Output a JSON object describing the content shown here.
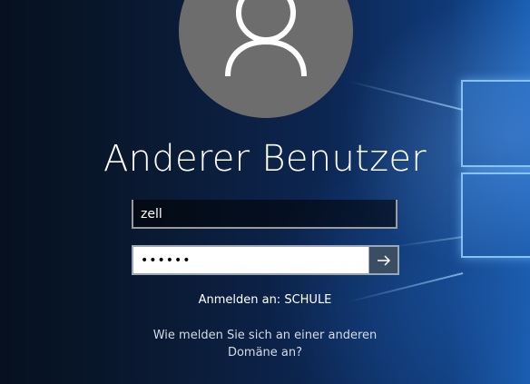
{
  "account": {
    "name": "Anderer Benutzer",
    "avatar_icon": "person-icon"
  },
  "login": {
    "username_value": "zell",
    "password_value": "••••••",
    "submit_icon": "arrow-right-icon"
  },
  "sign_in_to": "Anmelden an: SCHULE",
  "other_domain": {
    "line1": "Wie melden Sie sich an einer anderen",
    "line2": "Domäne an?"
  },
  "colors": {
    "avatar_bg": "#6d6d6d",
    "submit_bg": "#3a4d63",
    "text": "#ffffff"
  }
}
